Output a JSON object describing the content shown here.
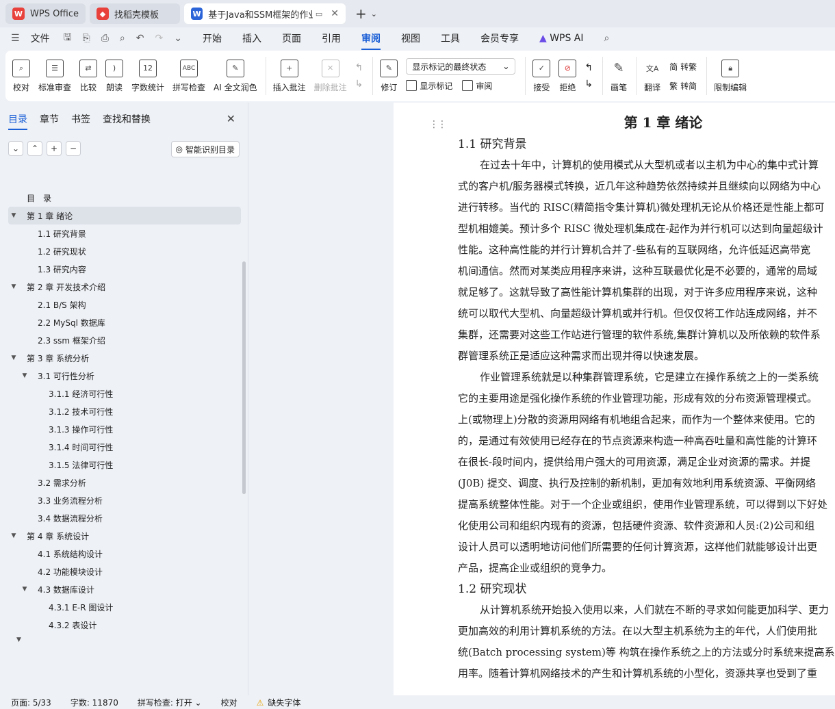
{
  "tabs": [
    {
      "label": "WPS Office",
      "icon": "wps-logo-icon",
      "color": "#e8413c"
    },
    {
      "label": "找稻壳模板",
      "icon": "docer-icon",
      "color": "#e8413c"
    },
    {
      "label": "基于Java和SSM框架的作业管",
      "icon": "writer-doc-icon",
      "color": "#2b64d8"
    }
  ],
  "menu": {
    "file": "文件",
    "items": [
      "开始",
      "插入",
      "页面",
      "引用",
      "审阅",
      "视图",
      "工具",
      "会员专享"
    ],
    "active": "审阅",
    "ai": "WPS AI"
  },
  "ribbon": {
    "proofread": "校对",
    "standard_review": "标准审查",
    "compare": "比较",
    "read_aloud": "朗读",
    "word_count": "字数统计",
    "spell_check": "拼写检查",
    "ai_polish": "AI 全文润色",
    "insert_comment": "插入批注",
    "delete_comment": "删除批注",
    "track_changes": "修订",
    "markup_select": "显示标记的最终状态",
    "show_markup": "显示标记",
    "review": "审阅",
    "accept": "接受",
    "reject": "拒绝",
    "ink": "画笔",
    "translate": "翻译",
    "to_simplified": "转繁",
    "to_traditional": "转简",
    "restrict_editing": "限制编辑"
  },
  "panel": {
    "tabs": [
      "目录",
      "章节",
      "书签",
      "查找和替换"
    ],
    "smart_toc": "智能识别目录",
    "toc": [
      {
        "label": "目　录",
        "level": 0,
        "arrow": ""
      },
      {
        "label": "第 1 章  绪论",
        "level": 0,
        "arrow": "▼",
        "selected": true
      },
      {
        "label": "1.1 研究背景",
        "level": 1,
        "arrow": ""
      },
      {
        "label": "1.2 研究现状",
        "level": 1,
        "arrow": ""
      },
      {
        "label": "1.3 研究内容",
        "level": 1,
        "arrow": ""
      },
      {
        "label": "第 2 章  开发技术介绍",
        "level": 0,
        "arrow": "▼"
      },
      {
        "label": "2.1 B/S 架构",
        "level": 1,
        "arrow": ""
      },
      {
        "label": "2.2 MySql 数据库",
        "level": 1,
        "arrow": ""
      },
      {
        "label": "2.3 ssm 框架介绍",
        "level": 1,
        "arrow": ""
      },
      {
        "label": "第 3 章  系统分析",
        "level": 0,
        "arrow": "▼"
      },
      {
        "label": "3.1 可行性分析",
        "level": 1,
        "arrow": "▼"
      },
      {
        "label": "3.1.1 经济可行性",
        "level": 2,
        "arrow": ""
      },
      {
        "label": "3.1.2 技术可行性",
        "level": 2,
        "arrow": ""
      },
      {
        "label": "3.1.3 操作可行性",
        "level": 2,
        "arrow": ""
      },
      {
        "label": "3.1.4  时间可行性",
        "level": 2,
        "arrow": ""
      },
      {
        "label": "3.1.5  法律可行性",
        "level": 2,
        "arrow": ""
      },
      {
        "label": "3.2 需求分析",
        "level": 1,
        "arrow": ""
      },
      {
        "label": "3.3 业务流程分析",
        "level": 1,
        "arrow": ""
      },
      {
        "label": "3.4 数据流程分析",
        "level": 1,
        "arrow": ""
      },
      {
        "label": "第 4 章  系统设计",
        "level": 0,
        "arrow": "▼"
      },
      {
        "label": "4.1 系统结构设计",
        "level": 1,
        "arrow": ""
      },
      {
        "label": "4.2 功能模块设计",
        "level": 1,
        "arrow": ""
      },
      {
        "label": "4.3 数据库设计",
        "level": 1,
        "arrow": "▼"
      },
      {
        "label": "4.3.1 E-R 图设计",
        "level": 2,
        "arrow": ""
      },
      {
        "label": "4.3.2 表设计",
        "level": 2,
        "arrow": ""
      }
    ]
  },
  "doc": {
    "chapter_title": "第 1 章  绪论",
    "section1_title": "1.1 研究背景",
    "section2_title": "1.2 研究现状",
    "para1": [
      "在过去十年中，计算机的使用模式从大型机或者以主机为中心的集中式计算",
      "式的客户机/服务器模式转换，近几年这种趋势依然持续并且继续向以网络为中心",
      "进行转移。当代的 RISC(精简指令集计算机)微处理机无论从价格还是性能上都可",
      "型机相媲美。预计多个 RISC 微处理机集成在-起作为并行机可以达到向量超级计",
      "性能。这种高性能的并行计算机合并了-些私有的互联网络，允许低延迟高带宽",
      "机间通信。然而对某类应用程序来讲，这种互联最优化是不必要的，通常的局域",
      "就足够了。这就导致了高性能计算机集群的出现，对于许多应用程序来说，这种",
      "统可以取代大型机、向量超级计算机或并行机。但仅仅将工作站连成网络，并不",
      "集群，还需要对这些工作站进行管理的软件系统,集群计算机以及所依赖的软件系",
      "群管理系统正是适应这种需求而出现并得以快速发展。"
    ],
    "para2": [
      "作业管理系统就是以种集群管理系统，它是建立在操作系统之上的一类系统",
      "它的主要用途是强化操作系统的作业管理功能，形成有效的分布资源管理模式。",
      "上(或物理上)分散的资源用网络有机地组合起来，而作为一个整体来使用。它的",
      "的，是通过有效使用已经存在的节点资源来构造一种高吞吐量和高性能的计算环",
      "在很长-段时间内，提供给用户强大的可用资源，满足企业对资源的需求。并提",
      "(J0B) 提交、调度、执行及控制的新机制，更加有效地利用系统资源、平衡网络",
      "提高系统整体性能。对于一个企业或组织，使用作业管理系统，可以得到以下好处",
      "化使用公司和组织内现有的资源，包括硬件资源、软件资源和人员:(2)公司和组",
      "设计人员可以透明地访问他们所需要的任何计算资源，这样他们就能够设计出更",
      "产品，提高企业或组织的竞争力。"
    ],
    "para3": [
      "从计算机系统开始投入使用以来，人们就在不断的寻求如何能更加科学、更力",
      "更加高效的利用计算机系统的方法。在以大型主机系统为主的年代，人们使用批",
      "统(Batch processing system)等 构筑在操作系统之上的方法或分时系统来提高系",
      "用率。随着计算机网络技术的产生和计算机系统的小型化，资源共享也受到了重"
    ]
  },
  "status": {
    "page": "页面: 5/33",
    "words": "字数: 11870",
    "spell": "拼写检查: 打开",
    "proof": "校对",
    "missing_font": "缺失字体"
  },
  "colors": {
    "accent": "#1a5fd6",
    "warning": "#e6a100"
  }
}
